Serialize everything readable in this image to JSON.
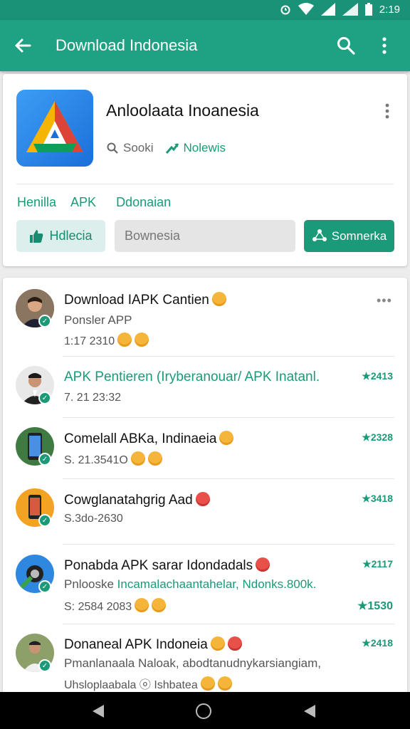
{
  "status_bar": {
    "time": "2:19"
  },
  "app_bar": {
    "title": "Download Indonesia",
    "back_icon": "arrow-back-icon",
    "search_icon": "search-icon",
    "more_icon": "more-vert-icon"
  },
  "app_info": {
    "name": "Anloolaata Inoanesia",
    "books": "Sooki",
    "reviews": "Nolewis",
    "tags": [
      "Henilla",
      "APK",
      "Ddonaian"
    ],
    "like_label": "Hdlecia",
    "search_placeholder": "Bownesia",
    "action_label": "Somnerka"
  },
  "list": [
    {
      "title": "Download IAPK Cantien",
      "subtitle": "Ponsler APP",
      "time": "1:17 2310",
      "count": "",
      "title_color": "default"
    },
    {
      "title": "APK Pentieren (Iryberanouar/ APK Inatanl.",
      "subtitle": "",
      "time": "7. 21 23:32",
      "count": "2413",
      "title_color": "green"
    },
    {
      "title": "Comelall ABKa, Indinaeia",
      "subtitle": "",
      "time": "S. 21.3541O",
      "count": "2328",
      "title_color": "default"
    },
    {
      "title": "Cowglanatahgrig Aad",
      "subtitle": "",
      "time": "S.3do-2630",
      "count": "3418",
      "title_color": "default"
    },
    {
      "title": "Ponabda APK sarar Idondadals",
      "subtitle_plain": "Pnlooske",
      "subtitle_highlight": "Incamalachaantahelar, Ndonks.800k.",
      "time": "S: 2584 2083",
      "count": "2117",
      "count2": "1530",
      "title_color": "default"
    },
    {
      "title": "Donaneal APK Indoneia",
      "subtitle": "Pmanlanaala Naloak, abodtanudnykarsiangiam,",
      "time": "Uhsloplaabala",
      "time_tail": "Ishbatea",
      "count": "2418",
      "title_color": "default"
    }
  ],
  "colors": {
    "primary": "#1fa184",
    "primary_dark": "#1a9277",
    "accent": "#1a9a78"
  }
}
